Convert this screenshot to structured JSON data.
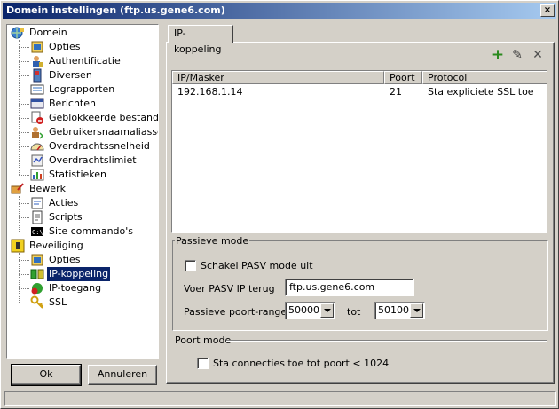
{
  "window": {
    "title": "Domein instellingen (ftp.us.gene6.com)",
    "close_label": "×"
  },
  "tree": {
    "items": [
      {
        "label": "Domein",
        "icon": "domain-globe-icon",
        "level": 0,
        "selected": false
      },
      {
        "label": "Opties",
        "icon": "options-icon",
        "level": 1,
        "selected": false
      },
      {
        "label": "Authentificatie",
        "icon": "authentication-icon",
        "level": 1,
        "selected": false
      },
      {
        "label": "Diversen",
        "icon": "misc-icon",
        "level": 1,
        "selected": false
      },
      {
        "label": "Lograpporten",
        "icon": "log-reports-icon",
        "level": 1,
        "selected": false
      },
      {
        "label": "Berichten",
        "icon": "messages-icon",
        "level": 1,
        "selected": false
      },
      {
        "label": "Geblokkeerde bestanden",
        "icon": "blocked-files-icon",
        "level": 1,
        "selected": false
      },
      {
        "label": "Gebruikersnaamaliassen",
        "icon": "user-alias-icon",
        "level": 1,
        "selected": false
      },
      {
        "label": "Overdrachtssnelheid",
        "icon": "transfer-speed-icon",
        "level": 1,
        "selected": false
      },
      {
        "label": "Overdrachtslimiet",
        "icon": "transfer-limit-icon",
        "level": 1,
        "selected": false
      },
      {
        "label": "Statistieken",
        "icon": "statistics-icon",
        "level": 1,
        "selected": false
      },
      {
        "label": "Bewerk",
        "icon": "edit-icon",
        "level": 0,
        "selected": false
      },
      {
        "label": "Acties",
        "icon": "actions-icon",
        "level": 1,
        "selected": false
      },
      {
        "label": "Scripts",
        "icon": "scripts-icon",
        "level": 1,
        "selected": false
      },
      {
        "label": "Site commando's",
        "icon": "site-commands-icon",
        "level": 1,
        "selected": false
      },
      {
        "label": "Beveiliging",
        "icon": "security-icon",
        "level": 0,
        "selected": false
      },
      {
        "label": "Opties",
        "icon": "options-icon",
        "level": 1,
        "selected": false
      },
      {
        "label": "IP-koppeling",
        "icon": "ip-binding-icon",
        "level": 1,
        "selected": true
      },
      {
        "label": "IP-toegang",
        "icon": "ip-access-icon",
        "level": 1,
        "selected": false
      },
      {
        "label": "SSL",
        "icon": "ssl-key-icon",
        "level": 1,
        "selected": false
      }
    ]
  },
  "buttons": {
    "ok": "Ok",
    "cancel": "Annuleren"
  },
  "tab": {
    "label": "IP-koppeling"
  },
  "toolbar": {
    "add": "+",
    "edit": "✎",
    "delete": "✕"
  },
  "list": {
    "headers": [
      "IP/Masker",
      "Poort",
      "Protocol"
    ],
    "rows": [
      [
        "192.168.1.14",
        "21",
        "Sta expliciete SSL toe"
      ]
    ]
  },
  "passive": {
    "title": "Passieve mode",
    "disable_pasv_label": "Schakel PASV mode uit",
    "disable_pasv_checked": false,
    "pasv_ip_label": "Voer PASV IP terug",
    "pasv_ip_value": "ftp.us.gene6.com",
    "range_label": "Passieve poort-range",
    "range_from": "50000",
    "range_to_label": "tot",
    "range_to": "50100"
  },
  "portmode": {
    "title": "Poort mode",
    "allow_low_ports_label": "Sta connecties toe tot poort < 1024",
    "allow_low_ports_checked": false
  }
}
